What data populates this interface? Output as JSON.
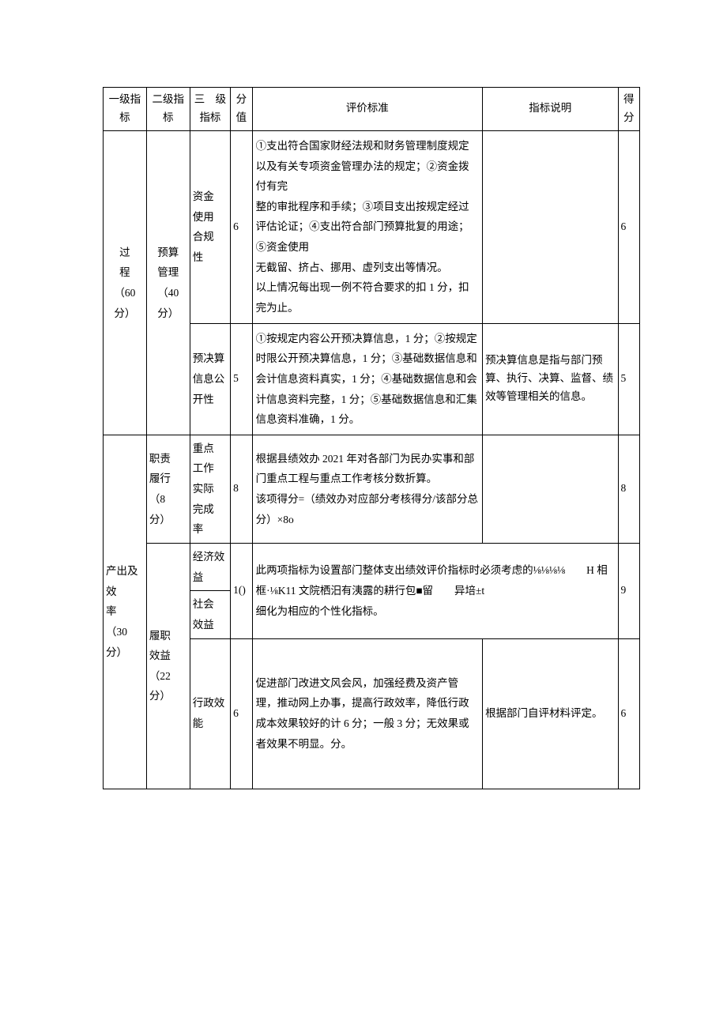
{
  "headers": {
    "level1": "一级指\n标",
    "level2": "二级指\n标",
    "level3": "三　级\n指标",
    "score": "分值",
    "criteria": "评价标准",
    "desc": "指标说明",
    "got": "得\n分"
  },
  "rows": {
    "l1_process": "过\n程\n（60\n分）",
    "l2_budget_mgmt": "预算\n管理\n（40\n分）",
    "l3_fund_use": "资金\n使用\n合规\n性",
    "score_fund_use": "6",
    "criteria_fund_use": "①支出符合国家财经法规和财务管理制度规定以及有关专项资金管理办法的规定；②资金拨付有完\n整的审批程序和手续；③项目支出按规定经过评估论证；④支出符合部门预算批复的用途；⑤资金使用\n无截留、挤占、挪用、虚列支出等情况。\n以上情况每出现一例不符合要求的扣 1 分，扣完为止。",
    "desc_fund_use": "",
    "got_fund_use": "6",
    "l3_budget_info": "预决算\n信息公\n开性",
    "score_budget_info": "5",
    "criteria_budget_info": "①按规定内容公开预决算信息，1 分；②按规定时限公开预决算信息，1 分；③基础数据信息和会计信息资料真实，1 分；④基础数据信息和会计信息资料完整，1 分；⑤基础数据信息和汇集信息资料准确，1 分。",
    "desc_budget_info": "预决算信息是指与部门预算、执行、决算、监督、绩效等管理相关的信息。",
    "got_budget_info": "5",
    "l1_output": "产出及\n效\n率\n（30\n分）",
    "l2_duty": "职责\n履行\n（8\n分）",
    "l3_key_work": "重点\n工作\n实际\n完成\n率",
    "score_key_work": "8",
    "criteria_key_work": "根据县绩效办 2021 年对各部门为民办实事和部门重点工程与重点工作考核分数折算。\n该项得分=（绩效办对应部分考核得分/该部分总分）×8o",
    "desc_key_work": "",
    "got_key_work": "8",
    "l2_perf_benefit": "履职\n效益\n（22\n分）",
    "l3_econ": "经济效\n益",
    "l3_social": "社会\n效益",
    "score_econ_social": "1()",
    "criteria_econ_social": "此两项指标为设置部门整体支出绩效评价指标时必须考虑的⅛⅛⅛⅛　　H 相框·⅛K11 文院栖汨有洟露的耕行包■留　　异培±t\n细化为相应的个性化指标。",
    "got_econ_social": "9",
    "l3_admin": "行政效\n能",
    "score_admin": "6",
    "criteria_admin": "促进部门改进文风会风，加强经费及资产管理，推动网上办事，提高行政效率，降低行政成本效果较好的计 6 分；一般 3 分；无效果或者效果不明显。分。",
    "desc_admin": "根据部门自评材料评定。",
    "got_admin": "6"
  }
}
